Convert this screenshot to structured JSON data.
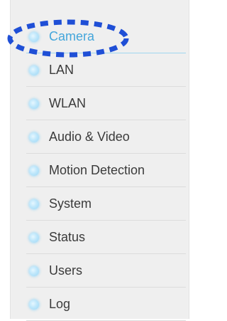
{
  "sidebar": {
    "items": [
      {
        "label": "Camera",
        "active": true
      },
      {
        "label": "LAN"
      },
      {
        "label": "WLAN"
      },
      {
        "label": "Audio & Video"
      },
      {
        "label": "Motion Detection"
      },
      {
        "label": "System"
      },
      {
        "label": "Status"
      },
      {
        "label": "Users"
      },
      {
        "label": "Log"
      }
    ]
  },
  "colors": {
    "panel_background": "#efefef",
    "active_text": "#44a6db",
    "default_text": "#3b3b3b",
    "annotation_ring": "#1f4fd6",
    "bullet": "#9cd7f5"
  },
  "icons": {
    "bullet": "glowing-bullet-icon"
  }
}
